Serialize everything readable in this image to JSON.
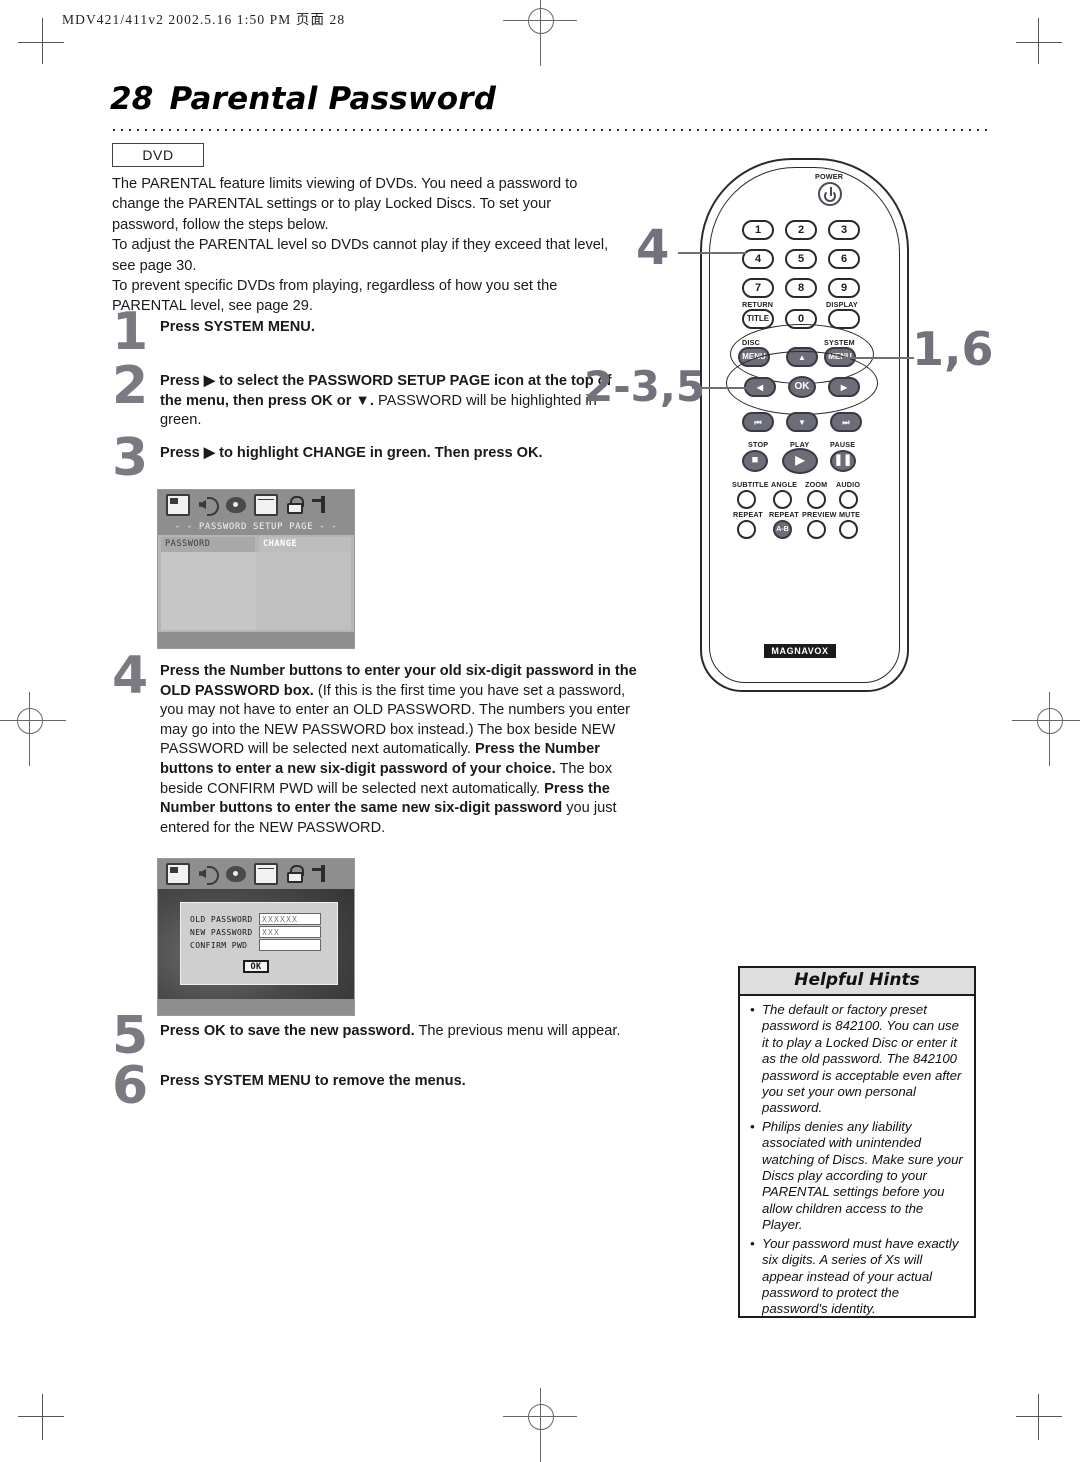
{
  "page_header": "MDV421/411v2  2002.5.16  1:50 PM  页面 28",
  "title": {
    "number": "28",
    "text": "Parental Password"
  },
  "badge": "DVD",
  "intro": [
    "The PARENTAL feature limits viewing of DVDs. You need a password to change the PARENTAL settings or to play Locked Discs. To set your password, follow the steps below.",
    "To adjust the PARENTAL level so DVDs cannot play if they exceed that level, see page 30.",
    "To prevent specific DVDs from playing, regardless of how you set the PARENTAL level, see page 29."
  ],
  "steps": [
    {
      "num": "1",
      "html": "<b>Press SYSTEM MENU.</b>"
    },
    {
      "num": "2",
      "html": "<b>Press &#9654; to select the PASSWORD SETUP PAGE icon at the top of the menu, then press OK or &#9660;.</b> PASSWORD will be highlighted in green."
    },
    {
      "num": "3",
      "html": "<b>Press &#9654; to highlight CHANGE in green. Then press OK.</b>"
    },
    {
      "num": "4",
      "html": "<b>Press the Number buttons to enter your old six-digit password in the OLD PASSWORD box.</b> (If this is the first time you have set a password, you may not have to enter an OLD PASSWORD. The numbers you enter may go into the NEW PASSWORD box instead.) The box beside NEW PASSWORD will be selected next automatically. <b>Press the Number buttons to enter a new six-digit password of your choice.</b> The box beside CONFIRM PWD will be selected next automatically. <b>Press the Number buttons to enter the same new six-digit password</b> you just entered for the NEW PASSWORD."
    },
    {
      "num": "5",
      "html": "<b>Press OK to save the new password.</b> The previous menu will appear."
    },
    {
      "num": "6",
      "html": "<b>Press SYSTEM MENU to remove the menus.</b>"
    }
  ],
  "osd_setup": {
    "title": "- -  PASSWORD  SETUP  PAGE  - -",
    "row_label": "PASSWORD",
    "row_value": "CHANGE",
    "icons": [
      "screen-icon",
      "speaker-icon",
      "disc-icon",
      "preferences-icon",
      "lock-icon",
      "exit-icon"
    ]
  },
  "osd_dialog": {
    "rows": [
      {
        "label": "OLD PASSWORD",
        "value": "XXXXXX"
      },
      {
        "label": "NEW PASSWORD",
        "value": "XXX"
      },
      {
        "label": "CONFIRM PWD",
        "value": ""
      }
    ],
    "ok_label": "OK"
  },
  "remote": {
    "power_label": "POWER",
    "numbers": [
      "1",
      "2",
      "3",
      "4",
      "5",
      "6",
      "7",
      "8",
      "9",
      "0"
    ],
    "return_label": "RETURN",
    "title_button": "TITLE",
    "display_label": "DISPLAY",
    "disc_label": "DISC",
    "system_label": "SYSTEM",
    "menu_button": "MENU",
    "ok_button": "OK",
    "stop_label": "STOP",
    "play_label": "PLAY",
    "pause_label": "PAUSE",
    "feature_row1": [
      "SUBTITLE",
      "ANGLE",
      "ZOOM",
      "AUDIO"
    ],
    "feature_row2": [
      "REPEAT",
      "REPEAT",
      "PREVIEW",
      "MUTE"
    ],
    "repeat_ab": "A-B",
    "brand": "MAGNAVOX",
    "callouts": {
      "numpad": "4",
      "system_menu": "1,6",
      "nav_ok": "2-3,5"
    }
  },
  "hints": {
    "heading": "Helpful Hints",
    "items": [
      "The default or factory preset password is 842100. You can use it to play a Locked Disc or enter it as the old password. The 842100 password is acceptable even after you set your own personal password.",
      "Philips denies any liability associated with unintended watching of Discs. Make sure your Discs play according to your PARENTAL settings before you allow children access to the Player.",
      "Your password must have exactly six digits. A series of Xs will appear instead of your actual password to protect the password's identity."
    ]
  },
  "colors": {
    "accent_gray": "#72727c",
    "osd_bg": "#b8b8b8",
    "ink": "#1a1a1a"
  }
}
